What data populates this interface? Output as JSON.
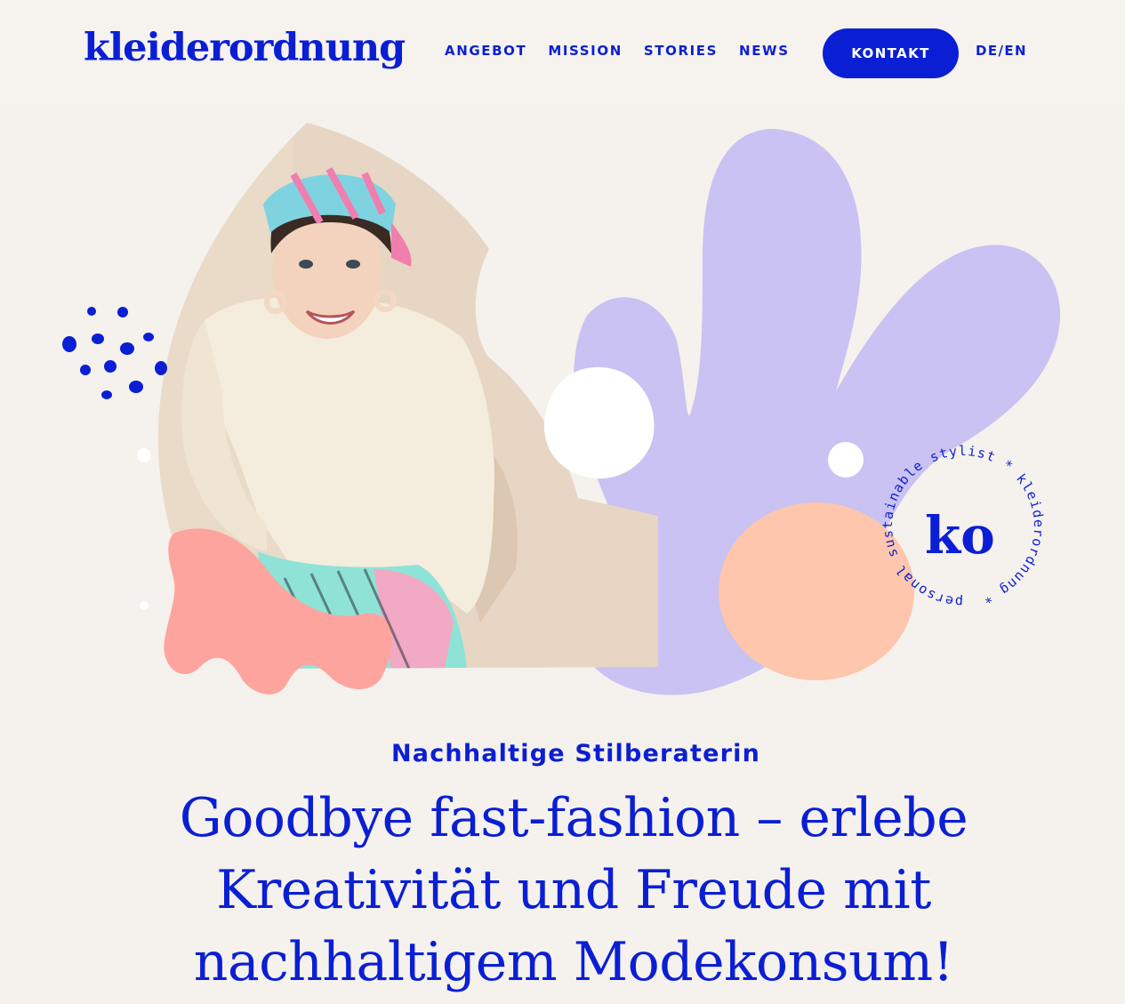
{
  "header": {
    "logo_text": "kleiderordnung",
    "nav": [
      {
        "label": "ANGEBOT"
      },
      {
        "label": "MISSION"
      },
      {
        "label": "STORIES"
      },
      {
        "label": "NEWS"
      }
    ],
    "cta_label": "KONTAKT",
    "lang": {
      "de": "DE",
      "separator": "/",
      "en": "EN"
    }
  },
  "hero": {
    "badge_ring_text": "personal sustainable stylist * kleiderordnung * ",
    "badge_monogram": "ko",
    "colors": {
      "brand_blue": "#0a1fd4",
      "lavender": "#c9c2f2",
      "peach": "#fec6ad",
      "coral": "#fea49e",
      "sand": "#e7d6c4",
      "background": "#f5f1ec"
    }
  },
  "eyebrow": "Nachhaltige Stilberaterin",
  "headline": "Goodbye fast-fashion – erlebe Kreativität und Freude mit nachhaltigem Modekonsum!"
}
